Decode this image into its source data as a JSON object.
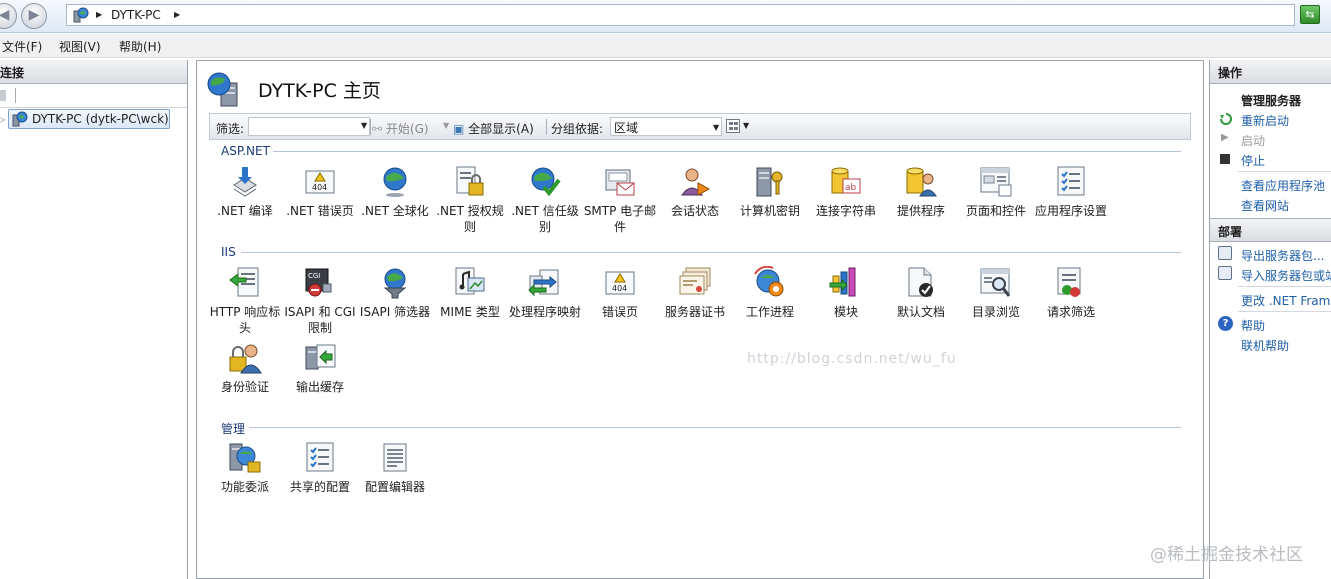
{
  "address_bar": {
    "path": "DYTK-PC"
  },
  "menu": {
    "items": [
      "文件(F)",
      "视图(V)",
      "帮助(H)"
    ]
  },
  "connections": {
    "title": "连接",
    "tree_node": "DYTK-PC (dytk-PC\\wck)"
  },
  "main": {
    "title": "DYTK-PC 主页",
    "filter": {
      "label": "筛选:",
      "value": "",
      "start_label": "开始(G)",
      "show_all_label": "全部显示(A)",
      "group_label": "分组依据:",
      "group_value": "区域"
    },
    "sections": [
      {
        "label": "ASP.NET",
        "items": [
          {
            "label": ".NET 编译",
            "icon": "download-arrow-icon"
          },
          {
            "label": ".NET 错误页",
            "icon": "error-404-icon"
          },
          {
            "label": ".NET 全球化",
            "icon": "globe-icon"
          },
          {
            "label": ".NET 授权规则",
            "icon": "lock-list-icon"
          },
          {
            "label": ".NET 信任级别",
            "icon": "globe-check-icon"
          },
          {
            "label": "SMTP 电子邮件",
            "icon": "email-icon"
          },
          {
            "label": "会话状态",
            "icon": "user-session-icon"
          },
          {
            "label": "计算机密钥",
            "icon": "server-key-icon"
          },
          {
            "label": "连接字符串",
            "icon": "database-ab-icon"
          },
          {
            "label": "提供程序",
            "icon": "database-user-icon"
          },
          {
            "label": "页面和控件",
            "icon": "page-controls-icon"
          },
          {
            "label": "应用程序设置",
            "icon": "checklist-icon"
          }
        ]
      },
      {
        "label": "IIS",
        "items": [
          {
            "label": "HTTP 响应标头",
            "icon": "http-headers-icon"
          },
          {
            "label": "ISAPI 和 CGI 限制",
            "icon": "cgi-restriction-icon"
          },
          {
            "label": "ISAPI 筛选器",
            "icon": "filter-globe-icon"
          },
          {
            "label": "MIME 类型",
            "icon": "mime-icon"
          },
          {
            "label": "处理程序映射",
            "icon": "handler-map-icon"
          },
          {
            "label": "错误页",
            "icon": "error-404-icon"
          },
          {
            "label": "服务器证书",
            "icon": "certificate-icon"
          },
          {
            "label": "工作进程",
            "icon": "worker-process-icon"
          },
          {
            "label": "模块",
            "icon": "modules-icon"
          },
          {
            "label": "默认文档",
            "icon": "default-document-icon"
          },
          {
            "label": "目录浏览",
            "icon": "directory-browse-icon"
          },
          {
            "label": "请求筛选",
            "icon": "request-filter-icon"
          },
          {
            "label": "身份验证",
            "icon": "auth-lock-user-icon"
          },
          {
            "label": "输出缓存",
            "icon": "output-cache-icon"
          }
        ]
      },
      {
        "label": "管理",
        "items": [
          {
            "label": "功能委派",
            "icon": "delegation-icon"
          },
          {
            "label": "共享的配置",
            "icon": "checklist-icon"
          },
          {
            "label": "配置编辑器",
            "icon": "config-editor-icon"
          }
        ]
      }
    ]
  },
  "actions": {
    "title": "操作",
    "manage_server": {
      "heading": "管理服务器",
      "restart": "重新启动",
      "start": "启动",
      "stop": "停止",
      "view_app_pools": "查看应用程序池",
      "view_sites": "查看网站"
    },
    "deploy": {
      "heading": "部署",
      "export": "导出服务器包...",
      "import": "导入服务器包或站",
      "change_net": "更改 .NET Frame"
    },
    "help": {
      "help": "帮助",
      "online_help": "联机帮助"
    }
  },
  "watermarks": {
    "center": "http://blog.csdn.net/wu_fu",
    "corner": "@稀土掘金技术社区"
  },
  "colors": {
    "link": "#1f5fa8",
    "section_label": "#1c3c7a",
    "pane_header": "#dadde2"
  }
}
